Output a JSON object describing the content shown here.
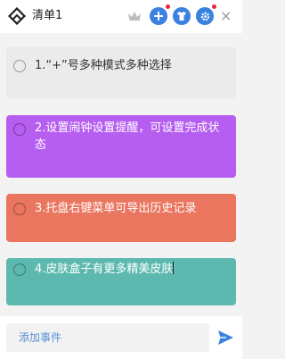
{
  "window": {
    "title": "清单1",
    "accent_color": "#3b82e0",
    "icons": [
      "app-logo-icon",
      "crown-icon",
      "add-icon",
      "shirt-icon",
      "gear-icon",
      "close-icon"
    ],
    "close_glyph": "×"
  },
  "tasks": [
    {
      "text": "1.“+”号多种模式多种选择",
      "color": "#ebebeb",
      "text_color": "#333333"
    },
    {
      "text": "2.设置闹钟设置提醒，可设置完成状态",
      "color": "#b55ef0",
      "text_color": "#ffffff"
    },
    {
      "text": "3.托盘右键菜单可导出历史记录",
      "color": "#ea7660",
      "text_color": "#ffffff"
    },
    {
      "text": "4.皮肤盒子有更多精美皮肤",
      "color": "#5db9af",
      "text_color": "#ffffff"
    }
  ],
  "composer": {
    "placeholder": "添加事件",
    "send_icon": "send-icon"
  }
}
